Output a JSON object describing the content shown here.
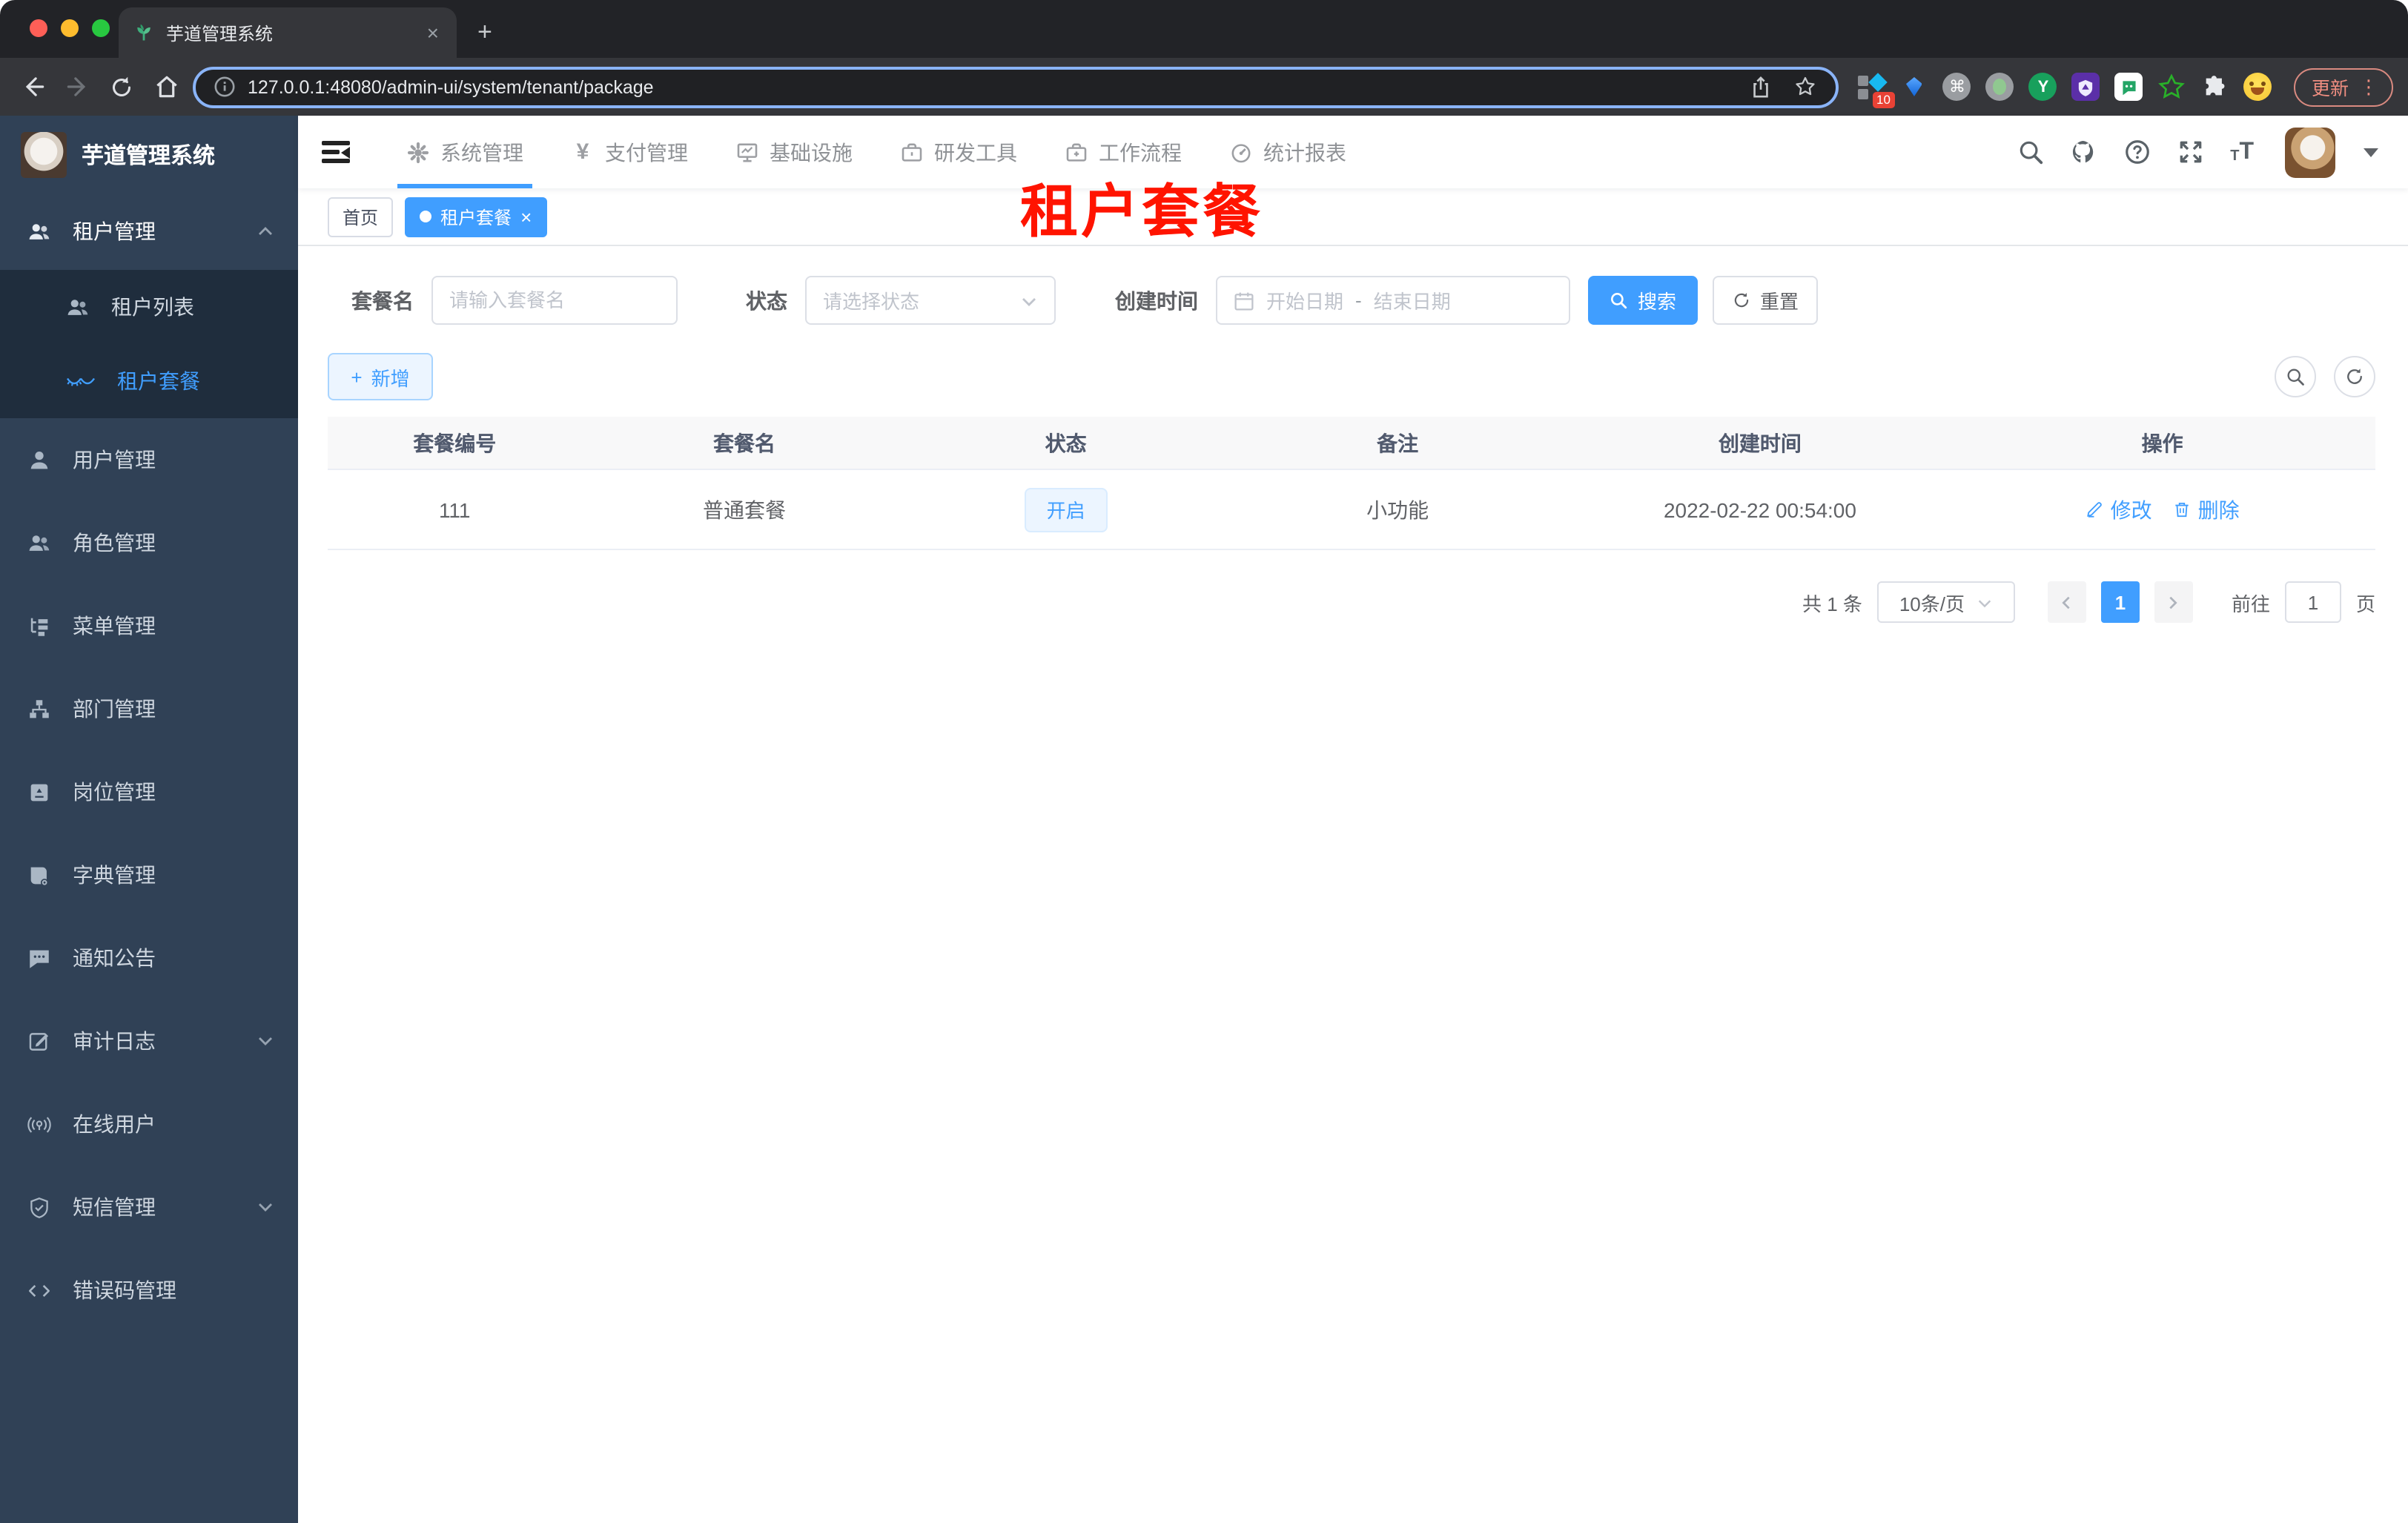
{
  "browser": {
    "tab_title": "芋道管理系统",
    "tab_close": "×",
    "new_tab": "+",
    "url": "127.0.0.1:48080/admin-ui/system/tenant/package",
    "extension_badge": "10",
    "extension_y_label": "Y",
    "command_glyph": "⌘",
    "update_label": "更新",
    "kebab": "⋮",
    "icons": [
      "back-icon",
      "forward-icon",
      "reload-icon",
      "home-icon",
      "info-icon",
      "share-icon",
      "star-icon"
    ]
  },
  "sidebar": {
    "logo_title": "芋道管理系统",
    "items": [
      {
        "label": "租户管理",
        "icon": "users-icon"
      },
      {
        "label": "租户列表",
        "icon": "tenant-list-icon"
      },
      {
        "label": "租户套餐",
        "icon": "tenant-package-icon"
      },
      {
        "label": "用户管理",
        "icon": "user-icon"
      },
      {
        "label": "角色管理",
        "icon": "roles-icon"
      },
      {
        "label": "菜单管理",
        "icon": "menu-tree-icon"
      },
      {
        "label": "部门管理",
        "icon": "org-chart-icon"
      },
      {
        "label": "岗位管理",
        "icon": "badge-icon"
      },
      {
        "label": "字典管理",
        "icon": "dictionary-icon"
      },
      {
        "label": "通知公告",
        "icon": "notice-icon"
      },
      {
        "label": "审计日志",
        "icon": "audit-log-icon"
      },
      {
        "label": "在线用户",
        "icon": "online-users-icon"
      },
      {
        "label": "短信管理",
        "icon": "sms-shield-icon"
      },
      {
        "label": "错误码管理",
        "icon": "error-code-icon"
      }
    ]
  },
  "nav": {
    "items": [
      {
        "label": "系统管理",
        "icon": "gear-icon"
      },
      {
        "label": "支付管理",
        "icon": "yen-icon",
        "glyph": "¥"
      },
      {
        "label": "基础设施",
        "icon": "monitor-icon"
      },
      {
        "label": "研发工具",
        "icon": "toolbox-icon"
      },
      {
        "label": "工作流程",
        "icon": "workflow-icon"
      },
      {
        "label": "统计报表",
        "icon": "dashboard-icon"
      }
    ]
  },
  "tags": {
    "home": "首页",
    "active": "租户套餐",
    "close": "×"
  },
  "annotation": "租户套餐",
  "filters": {
    "name_label": "套餐名",
    "name_placeholder": "请输入套餐名",
    "status_label": "状态",
    "status_placeholder": "请选择状态",
    "time_label": "创建时间",
    "start_placeholder": "开始日期",
    "separator": "-",
    "end_placeholder": "结束日期",
    "search": "搜索",
    "reset": "重置"
  },
  "toolbar": {
    "add": "新增",
    "plus": "+"
  },
  "table": {
    "columns": [
      "套餐编号",
      "套餐名",
      "状态",
      "备注",
      "创建时间",
      "操作"
    ],
    "row": {
      "id": "111",
      "name": "普通套餐",
      "status": "开启",
      "remark": "小功能",
      "create_time": "2022-02-22 00:54:00",
      "edit": "修改",
      "delete": "删除"
    }
  },
  "pagination": {
    "total": "共 1 条",
    "page_size": "10条/页",
    "current": "1",
    "goto_label": "前往",
    "goto_value": "1",
    "unit": "页"
  },
  "colors": {
    "accent": "#409eff",
    "sidebar_bg": "#304156",
    "submenu_bg": "#1f2d3d",
    "annotation_red": "#ff1400",
    "status_tag_bg": "#ecf5ff",
    "table_header_bg": "#f8f8f9"
  }
}
